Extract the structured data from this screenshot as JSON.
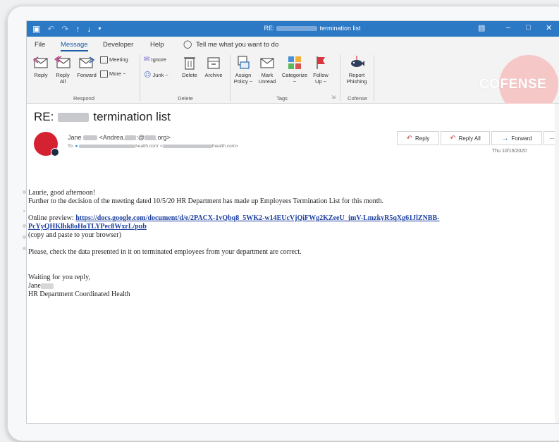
{
  "window": {
    "title_prefix": "RE:",
    "title_suffix": "termination list"
  },
  "menu": {
    "items": [
      "File",
      "Message",
      "Developer",
      "Help"
    ],
    "active": "Message",
    "tell_me": "Tell me what you want to do"
  },
  "ribbon": {
    "respond": {
      "reply": "Reply",
      "reply_all_1": "Reply",
      "reply_all_2": "All",
      "forward": "Forward",
      "meeting": "Meeting",
      "more": "More ~",
      "group": "Respond"
    },
    "delete": {
      "ignore": "Ignore",
      "junk": "Junk ~",
      "delete": "Delete",
      "archive": "Archive",
      "group": "Delete"
    },
    "tags": {
      "assign_1": "Assign",
      "assign_2": "Policy ~",
      "mark_1": "Mark",
      "mark_2": "Unread",
      "categorize_1": "Categorize",
      "categorize_2": "~",
      "follow_1": "Follow",
      "follow_2": "Up ~",
      "group": "Tags"
    },
    "cofense": {
      "report_1": "Report",
      "report_2": "Phishing",
      "group": "Cofense"
    },
    "brand": "COFENSE"
  },
  "message": {
    "subject_prefix": "RE:",
    "subject_suffix": "termination list",
    "sender_name": "Jane",
    "sender_email_a": "<Andrea.",
    "sender_email_b": ":@",
    "sender_email_c": ".org>",
    "to_label": "To:",
    "to_part_a": "health.com' <",
    "to_part_b": "lhealth.com>",
    "date": "Thu 10/15/2020",
    "actions": {
      "reply": "Reply",
      "reply_all": "Reply All",
      "forward": "Forward",
      "more": "···"
    },
    "body": {
      "greeting": "Laurie, good afternoon!",
      "line1": "Further to the decision of the meeting dated 10/5/20 HR Department has made up Employees Termination List for this month.",
      "preview_label": "Online preview: ",
      "link": "https://docs.google.com/document/d/e/2PACX-1vQbq8_5WK2-w14EUcVjQiFWg2KZeeU_jmV-LmzkyR5qXg61JlZNBB-PcYyQHKlhk8oHoTLYPec8WxrL/pub",
      "copy_note": "(copy and paste to your browser)",
      "line2": "Please, check the data presented in it on terminated employees from your department are correct.",
      "closing": "Waiting for you reply,",
      "sig_name": "Jane",
      "sig_dept": "HR Department Coordinated Health"
    }
  }
}
